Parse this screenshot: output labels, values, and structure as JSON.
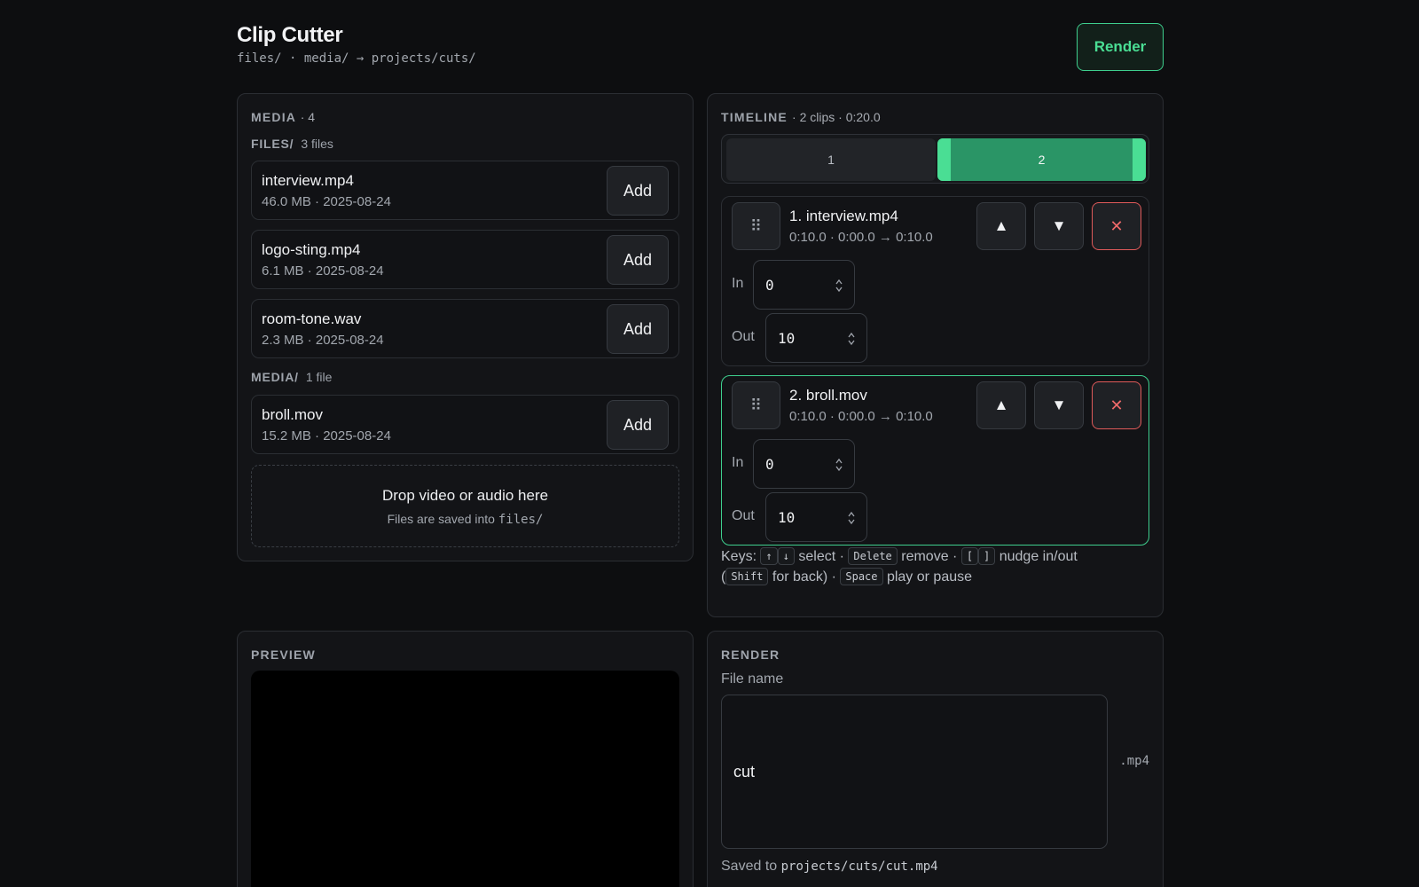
{
  "header": {
    "title": "Clip Cutter",
    "breadcrumb": "files/ · media/ → projects/cuts/",
    "render_label": "Render"
  },
  "media": {
    "label": "MEDIA",
    "count_text": "· 4",
    "folders": [
      {
        "name": "FILES/",
        "count": "3 files",
        "files": [
          {
            "name": "interview.mp4",
            "meta": "46.0 MB · 2025-08-24",
            "add_label": "Add"
          },
          {
            "name": "logo-sting.mp4",
            "meta": "6.1 MB · 2025-08-24",
            "add_label": "Add"
          },
          {
            "name": "room-tone.wav",
            "meta": "2.3 MB · 2025-08-24",
            "add_label": "Add"
          }
        ]
      },
      {
        "name": "MEDIA/",
        "count": "1 file",
        "files": [
          {
            "name": "broll.mov",
            "meta": "15.2 MB · 2025-08-24",
            "add_label": "Add"
          }
        ]
      }
    ],
    "dropzone": {
      "title": "Drop video or audio here",
      "subtitle_prefix": "Files are saved into ",
      "subtitle_path": "files/"
    }
  },
  "timeline": {
    "label": "TIMELINE",
    "meta": "· 2 clips · 0:20.0",
    "segments": [
      {
        "label": "1",
        "selected": false
      },
      {
        "label": "2",
        "selected": true
      }
    ],
    "clips": [
      {
        "title": "1. interview.mp4",
        "meta": "0:10.0 · 0:00.0 → 0:10.0",
        "in_label": "In",
        "in_value": "0",
        "out_label": "Out",
        "out_value": "10",
        "selected": false
      },
      {
        "title": "2. broll.mov",
        "meta": "0:10.0 · 0:00.0 → 0:10.0",
        "in_label": "In",
        "in_value": "0",
        "out_label": "Out",
        "out_value": "10",
        "selected": true
      }
    ],
    "clip_icons": {
      "drag": "⠿",
      "up": "▲",
      "down": "▼",
      "remove": "✕"
    },
    "keys": {
      "prefix": "Keys:",
      "up": "↑",
      "down": "↓",
      "select": "select ·",
      "delete": "Delete",
      "remove": "remove ·",
      "bracket_l": "[",
      "bracket_r": "]",
      "nudge": "nudge in/out",
      "paren_open": "(",
      "shift": "Shift",
      "for_back": "for back) ·",
      "space": "Space",
      "play": "play or pause"
    }
  },
  "preview": {
    "label": "PREVIEW"
  },
  "render": {
    "label": "RENDER",
    "file_name_label": "File name",
    "file_name_value": "cut",
    "extension": ".mp4",
    "saved_prefix": "Saved to",
    "saved_path": "projects/cuts/cut.mp4"
  }
}
